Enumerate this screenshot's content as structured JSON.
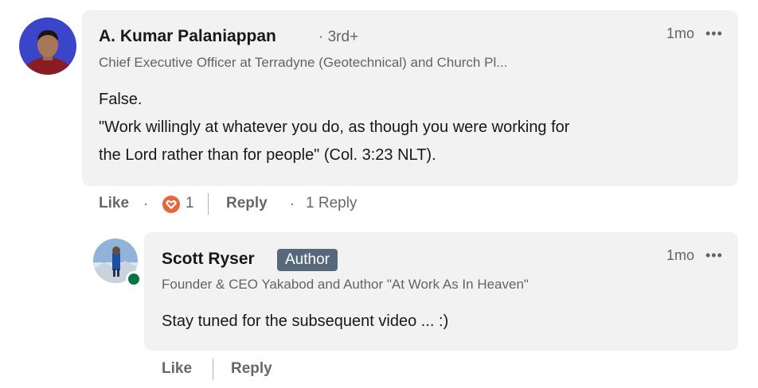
{
  "comment": {
    "author_name": "A. Kumar Palaniappan",
    "degree": "· 3rd+",
    "headline": "Chief Executive Officer at Terradyne (Geotechnical) and Church Pl...",
    "time": "1mo",
    "more": "•••",
    "body": [
      "False.",
      "\"Work willingly at whatever you do, as though you were working for",
      "the Lord rather than for people\" (Col. 3:23 NLT)."
    ],
    "actions": {
      "like": "Like",
      "dot1": "·",
      "reaction_count": "1",
      "reply": "Reply",
      "dot2": "·",
      "replies": "1 Reply"
    }
  },
  "reply": {
    "author_name": "Scott Ryser",
    "badge": "Author",
    "headline": "Founder & CEO Yakabod and Author \"At Work As In Heaven\"",
    "time": "1mo",
    "more": "•••",
    "body": "Stay tuned for the subsequent video ... :)",
    "actions": {
      "like": "Like",
      "reply": "Reply"
    }
  },
  "colors": {
    "bubble": "#f2f2f2",
    "badge": "#56687a",
    "reaction": "#e7643c",
    "online": "#057642"
  }
}
